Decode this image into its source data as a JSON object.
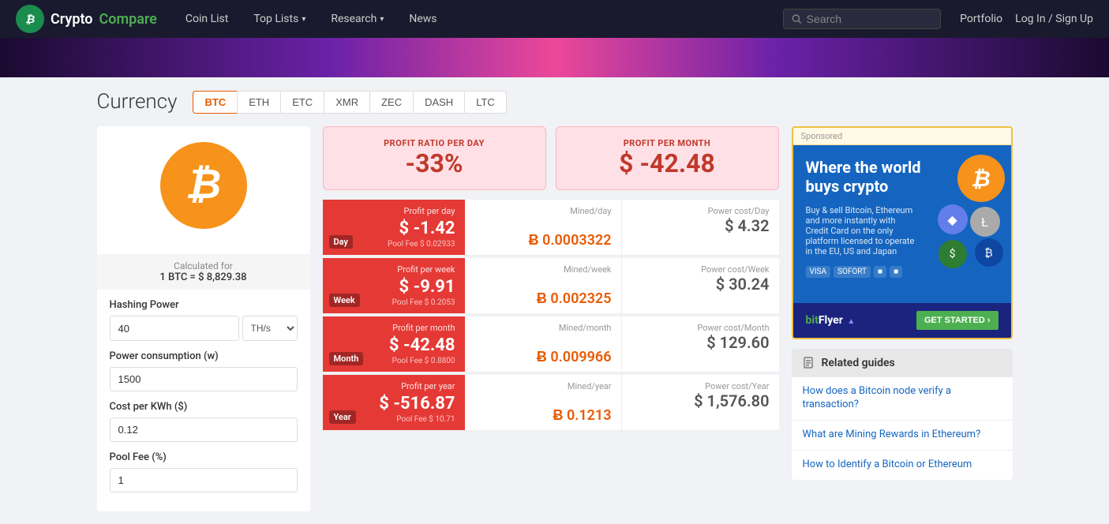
{
  "brand": {
    "logo_text": "₿",
    "name_crypto": "Crypto",
    "name_compare": "Compare"
  },
  "nav": {
    "coin_list": "Coin List",
    "top_lists": "Top Lists",
    "research": "Research",
    "news": "News",
    "search_placeholder": "Search",
    "portfolio": "Portfolio",
    "login": "Log In / Sign Up"
  },
  "currency": {
    "title": "Currency",
    "tabs": [
      "BTC",
      "ETH",
      "ETC",
      "XMR",
      "ZEC",
      "DASH",
      "LTC"
    ],
    "active_tab": "BTC"
  },
  "calculator": {
    "calc_for_label": "Calculated for",
    "calc_for_value": "1 BTC = $ 8,829.38",
    "hashing_power_label": "Hashing Power",
    "hashing_power_value": "40",
    "hashing_power_unit": "TH/s",
    "power_consumption_label": "Power consumption (w)",
    "power_consumption_value": "1500",
    "cost_per_kwh_label": "Cost per KWh ($)",
    "cost_per_kwh_value": "0.12",
    "pool_fee_label": "Pool Fee (%)",
    "pool_fee_value": "1"
  },
  "summary": {
    "profit_ratio_label": "PROFIT RATIO PER DAY",
    "profit_ratio_value": "-33%",
    "profit_month_label": "PROFIT PER MONTH",
    "profit_month_value": "$ -42.48"
  },
  "rows": [
    {
      "period": "Day",
      "profit_label": "Profit per day",
      "profit_value": "$ -1.42",
      "pool_fee": "Pool Fee $ 0.02933",
      "mined_label": "Mined/day",
      "mined_value": "Ƀ 0.0003322",
      "power_label": "Power cost/Day",
      "power_value": "$ 4.32"
    },
    {
      "period": "Week",
      "profit_label": "Profit per week",
      "profit_value": "$ -9.91",
      "pool_fee": "Pool Fee $ 0.2053",
      "mined_label": "Mined/week",
      "mined_value": "Ƀ 0.002325",
      "power_label": "Power cost/Week",
      "power_value": "$ 30.24"
    },
    {
      "period": "Month",
      "profit_label": "Profit per month",
      "profit_value": "$ -42.48",
      "pool_fee": "Pool Fee $ 0.8800",
      "mined_label": "Mined/month",
      "mined_value": "Ƀ 0.009966",
      "power_label": "Power cost/Month",
      "power_value": "$ 129.60"
    },
    {
      "period": "Year",
      "profit_label": "Profit per year",
      "profit_value": "$ -516.87",
      "pool_fee": "Pool Fee $ 10.71",
      "mined_label": "Mined/year",
      "mined_value": "Ƀ 0.1213",
      "power_label": "Power cost/Year",
      "power_value": "$ 1,576.80"
    }
  ],
  "ad": {
    "sponsored_label": "Sponsored",
    "title": "Where the world buys crypto",
    "description": "Buy & sell Bitcoin, Ethereum and more instantly with Credit Card on the only platform licensed to operate in the EU, US and Japan",
    "payments": [
      "VISA",
      "SOFORT"
    ],
    "brand_name": "bitFlyer",
    "cta_button": "GET STARTED ›"
  },
  "related_guides": {
    "header": "Related guides",
    "items": [
      "How does a Bitcoin node verify a transaction?",
      "What are Mining Rewards in Ethereum?",
      "How to Identify a Bitcoin or Ethereum"
    ]
  }
}
